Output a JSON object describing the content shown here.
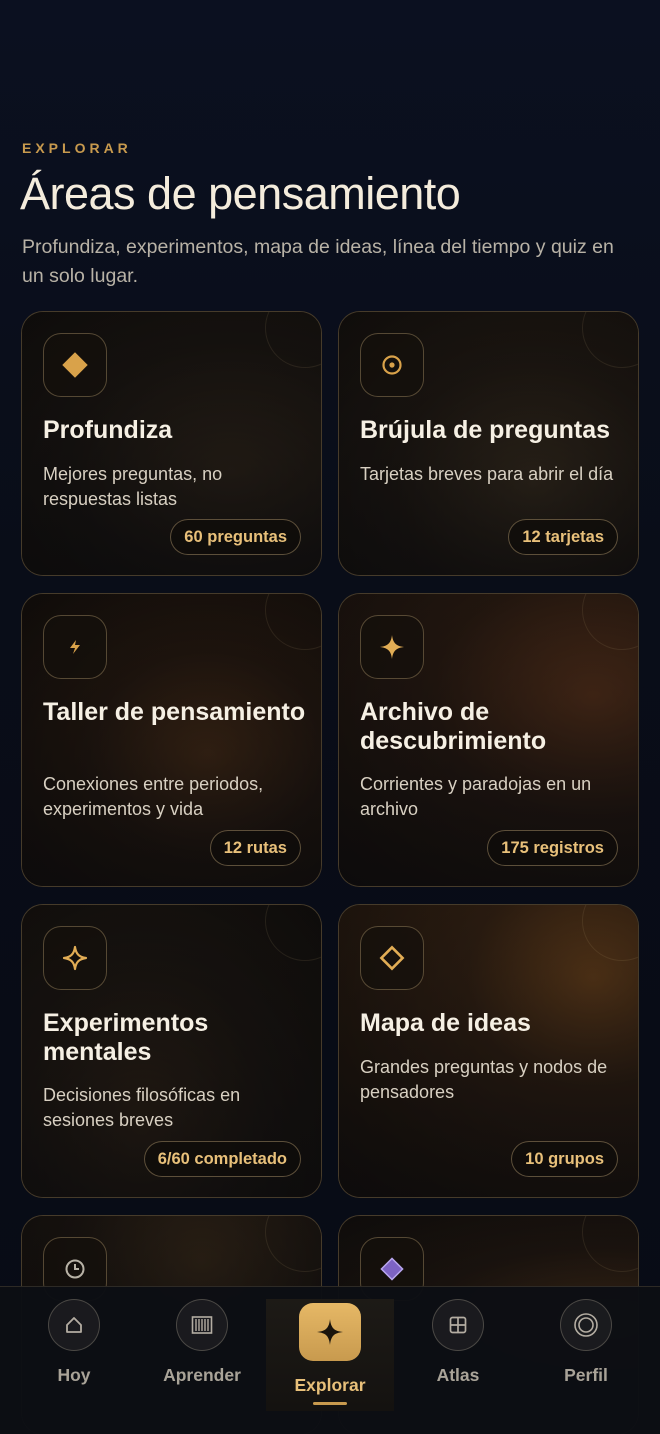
{
  "header": {
    "eyebrow": "EXPLORAR",
    "title": "Áreas de pensamiento",
    "subtitle": "Profundiza, experimentos, mapa de ideas, línea del tiempo y quiz en un solo lugar."
  },
  "cards": [
    {
      "icon": "diamond-icon",
      "title": "Profundiza",
      "description": "Mejores preguntas, no respuestas listas",
      "badge": "60 preguntas"
    },
    {
      "icon": "target-icon",
      "title": "Brújula de preguntas",
      "description": "Tarjetas breves para abrir el día",
      "badge": "12 tarjetas"
    },
    {
      "icon": "lightning-icon",
      "title": "Taller de pensamiento",
      "description": "Conexiones entre periodos, experimentos y vida",
      "badge": "12 rutas"
    },
    {
      "icon": "sparkle-icon",
      "title": "Archivo de descubrimiento",
      "description": "Corrientes y paradojas en un archivo",
      "badge": "175 registros"
    },
    {
      "icon": "sparkle-outline-icon",
      "title": "Experimentos mentales",
      "description": "Decisiones filosóficas en sesiones breves",
      "badge": "6/60 completado"
    },
    {
      "icon": "diamond-outline-icon",
      "title": "Mapa de ideas",
      "description": "Grandes preguntas y nodos de pensadores",
      "badge": "10 grupos"
    },
    {
      "icon": "clock-icon",
      "title": "",
      "description": "",
      "badge": ""
    },
    {
      "icon": "purple-diamond-icon",
      "title": "",
      "description": "",
      "badge": ""
    }
  ],
  "tabbar": {
    "tabs": [
      {
        "label": "Hoy",
        "icon": "home-icon"
      },
      {
        "label": "Aprender",
        "icon": "books-icon"
      },
      {
        "label": "Explorar",
        "icon": "star-icon",
        "active": true
      },
      {
        "label": "Atlas",
        "icon": "grid-icon"
      },
      {
        "label": "Perfil",
        "icon": "profile-icon"
      }
    ]
  },
  "colors": {
    "accent": "#c89a4e",
    "background": "#0a0e1a",
    "badge_text": "#e8c07a"
  }
}
